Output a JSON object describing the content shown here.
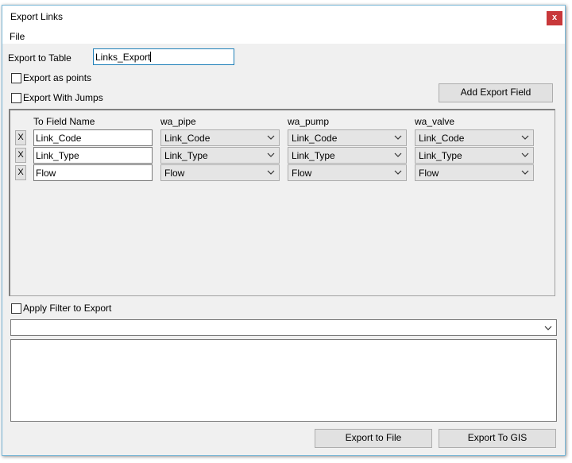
{
  "window": {
    "title": "Export Links",
    "close_label": "x"
  },
  "menu": {
    "file": "File"
  },
  "export_table": {
    "label": "Export to Table",
    "value": "Links_Export"
  },
  "options": {
    "export_as_points": "Export as points",
    "export_with_jumps": "Export With Jumps"
  },
  "add_export_field": "Add Export Field",
  "grid": {
    "headers": [
      "To Field Name",
      "wa_pipe",
      "wa_pump",
      "wa_valve"
    ],
    "delete_label": "X",
    "rows": [
      {
        "field": "Link_Code",
        "wa_pipe": "Link_Code",
        "wa_pump": "Link_Code",
        "wa_valve": "Link_Code"
      },
      {
        "field": "Link_Type",
        "wa_pipe": "Link_Type",
        "wa_pump": "Link_Type",
        "wa_valve": "Link_Type"
      },
      {
        "field": "Flow",
        "wa_pipe": "Flow",
        "wa_pump": "Flow",
        "wa_valve": "Flow"
      }
    ]
  },
  "filter": {
    "label": "Apply Filter to Export",
    "value": "",
    "expression": ""
  },
  "buttons": {
    "export_to_file": "Export to File",
    "export_to_gis": "Export To GIS"
  },
  "icons": {
    "dropdown": "chevron-down-icon"
  }
}
